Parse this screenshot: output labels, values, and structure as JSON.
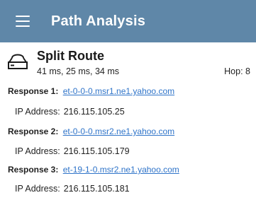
{
  "app_bar": {
    "title": "Path Analysis",
    "menu_icon": "hamburger-menu-icon",
    "background_color": "#5f87a8"
  },
  "route": {
    "icon": "router-icon",
    "name": "Split Route",
    "times": "41 ms, 25 ms, 34 ms",
    "hop": "Hop: 8"
  },
  "responses": [
    {
      "label": "Response 1:",
      "host": "et-0-0-0.msr1.ne1.yahoo.com",
      "ip_label": "IP Address:",
      "ip": "216.115.105.25"
    },
    {
      "label": "Response 2:",
      "host": "et-0-0-0.msr2.ne1.yahoo.com",
      "ip_label": "IP Address:",
      "ip": "216.115.105.179"
    },
    {
      "label": "Response 3:",
      "host": "et-19-1-0.msr2.ne1.yahoo.com",
      "ip_label": "IP Address:",
      "ip": "216.115.105.181"
    }
  ],
  "colors": {
    "link": "#2f74c9",
    "text": "#222222"
  }
}
